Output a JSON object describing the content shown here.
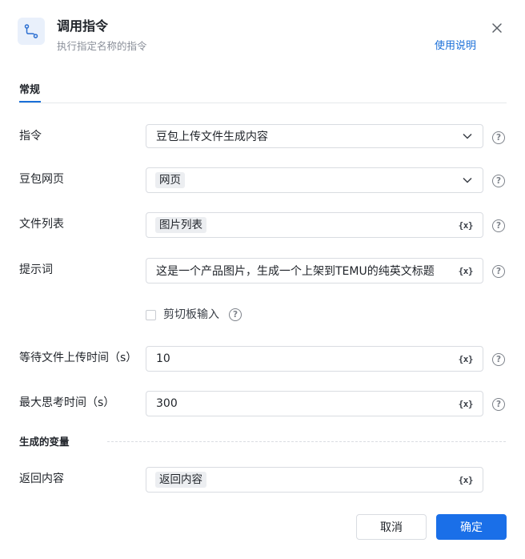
{
  "header": {
    "title": "调用指令",
    "subtitle": "执行指定名称的指令",
    "help_link": "使用说明",
    "icon": "flow-branch-icon",
    "close_icon": "close-icon"
  },
  "tabs": [
    {
      "label": "常规",
      "active": true
    }
  ],
  "form": {
    "command": {
      "label": "指令",
      "value": "豆包上传文件生成内容"
    },
    "webpage": {
      "label": "豆包网页",
      "value": "网页"
    },
    "file_list": {
      "label": "文件列表",
      "value": "图片列表"
    },
    "prompt": {
      "label": "提示词",
      "value": "这是一个产品图片，生成一个上架到TEMU的纯英文标题"
    },
    "clipboard_input": {
      "label": "剪切板输入",
      "checked": false
    },
    "upload_wait": {
      "label": "等待文件上传时间（s）",
      "value": "10"
    },
    "max_think": {
      "label": "最大思考时间（s）",
      "value": "300"
    }
  },
  "output_section": {
    "title": "生成的变量",
    "return_content": {
      "label": "返回内容",
      "value": "返回内容"
    }
  },
  "icons": {
    "variable": "{x}",
    "help": "?"
  },
  "footer": {
    "cancel": "取消",
    "confirm": "确定"
  },
  "colors": {
    "accent": "#1a6fe8",
    "link": "#1a6fd8"
  }
}
